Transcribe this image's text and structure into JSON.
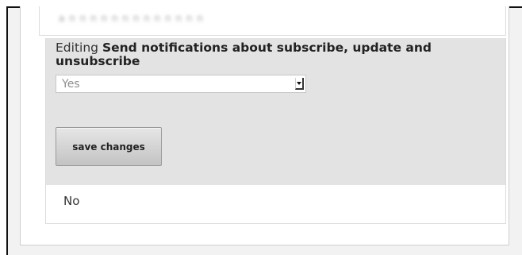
{
  "previous_row": {
    "blurred_text": "a n n n n n n n n n n n n n"
  },
  "editor": {
    "prefix": "Editing",
    "setting_name": "Send notifications about subscribe, update and unsubscribe",
    "select": {
      "selected_value": "Yes",
      "options_visible": [
        "Yes"
      ]
    },
    "save_label": "save changes"
  },
  "current_value": {
    "text": "No"
  },
  "colors": {
    "edit_background": "#e3e3e3",
    "page_background": "#f2f2f2",
    "button_gradient_top": "#e6e6e6",
    "button_gradient_bottom": "#c3c3c3"
  },
  "icons": {
    "select_arrow": "chevron-down-icon"
  }
}
